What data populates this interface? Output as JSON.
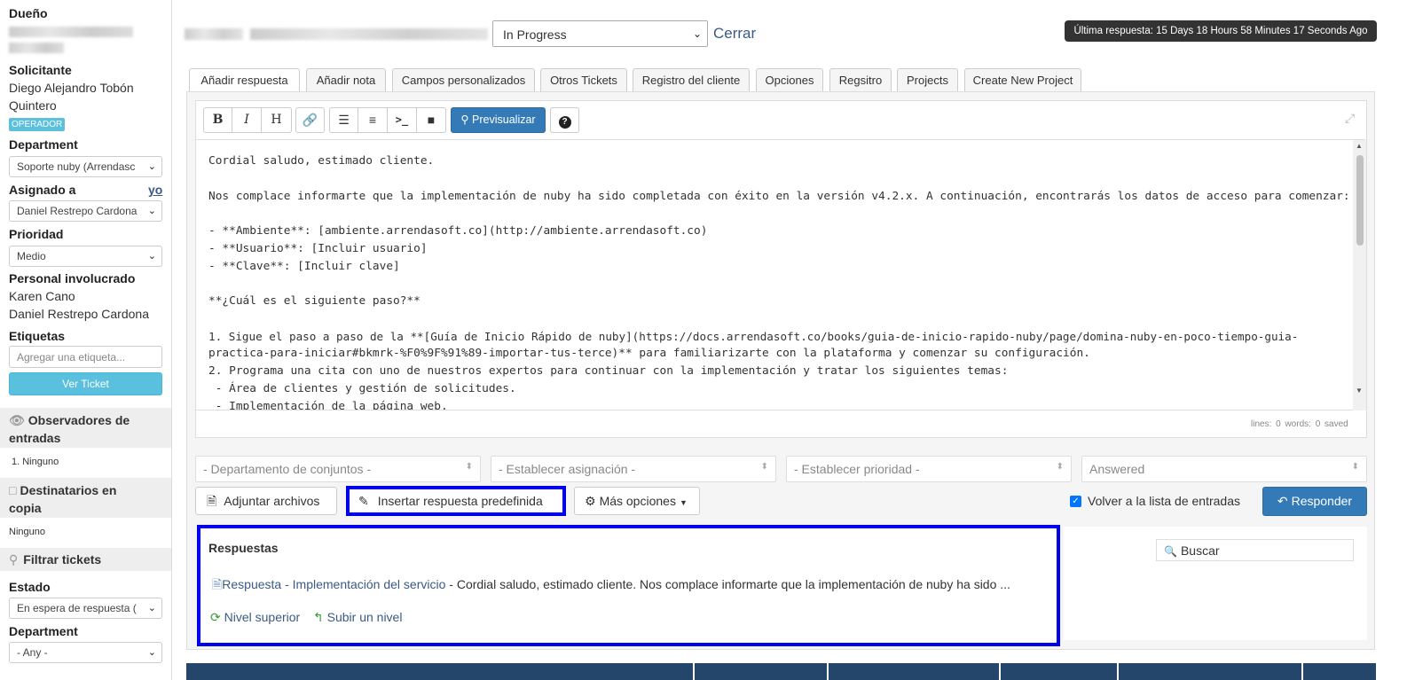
{
  "sidebar": {
    "owner_label": "Dueño",
    "requester_label": "Solicitante",
    "requester_name_line1": "Diego Alejandro Tobón",
    "requester_name_line2": "Quintero",
    "requester_badge": "OPERADOR",
    "department_label": "Department",
    "department_value": "Soporte nuby (Arrendasc",
    "assigned_label": "Asignado a",
    "assigned_me_link": "yo",
    "assigned_value": "Daniel Restrepo Cardona",
    "priority_label": "Prioridad",
    "priority_value": "Medio",
    "involved_label": "Personal involucrado",
    "involved": [
      "Karen Cano",
      "Daniel Restrepo Cardona"
    ],
    "tags_label": "Etiquetas",
    "tags_placeholder": "Agregar una etiqueta...",
    "view_ticket_button": "Ver Ticket",
    "watchers_label_line1": "Observadores de",
    "watchers_label_line2": "entradas",
    "watchers_item": "1. Ninguno",
    "cc_label_line1": "Destinatarios en",
    "cc_label_line2": "copia",
    "cc_item": "Ninguno",
    "filter_label": "Filtrar tickets",
    "state_label": "Estado",
    "state_value": "En espera de respuesta (",
    "filter_department_label": "Department",
    "filter_department_value": "- Any -"
  },
  "header": {
    "status_value": "In Progress",
    "close_link": "Cerrar",
    "last_reply": "Última respuesta: 15 Days 18 Hours 58 Minutes 17 Seconds Ago"
  },
  "tabs": [
    {
      "label": "Añadir respuesta",
      "active": true
    },
    {
      "label": "Añadir nota"
    },
    {
      "label": "Campos personalizados"
    },
    {
      "label": "Otros Tickets"
    },
    {
      "label": "Registro del cliente"
    },
    {
      "label": "Opciones"
    },
    {
      "label": "Regsitro"
    },
    {
      "label": "Projects"
    },
    {
      "label": "Create New Project"
    }
  ],
  "toolbar": {
    "bold": "B",
    "italic": "I",
    "heading": "H",
    "preview": "Previsualizar",
    "help": "?"
  },
  "editor": {
    "lines": [
      "Cordial saludo, estimado cliente.",
      "",
      "Nos complace informarte que la implementación de nuby ha sido completada con éxito en la versión v4.2.x. A continuación, encontrarás los datos de acceso para comenzar:",
      "",
      "- **Ambiente**: [ambiente.arrendasoft.co](http://ambiente.arrendasoft.co)",
      "- **Usuario**: [Incluir usuario]",
      "- **Clave**: [Incluir clave]",
      "",
      "**¿Cuál es el siguiente paso?**",
      "",
      "1. Sigue el paso a paso de la **[Guía de Inicio Rápido de nuby](https://docs.arrendasoft.co/books/guia-de-inicio-rapido-nuby/page/domina-nuby-en-poco-tiempo-guia-",
      "practica-para-iniciar#bkmrk-%F0%9F%91%89-importar-tus-terce)** para familiarizarte con la plataforma y comenzar su configuración.",
      "2. Programa una cita con uno de nuestros expertos para continuar con la implementación y tratar los siguientes temas:",
      " - Área de clientes y gestión de solicitudes.",
      " - Implementación de la página web."
    ],
    "status": "lines: 0   words: 0   saved"
  },
  "bottom_selects": {
    "department": "- Departamento de conjuntos -",
    "assignment": "- Establecer asignación -",
    "priority": "- Establecer prioridad -",
    "status": "Answered"
  },
  "actions": {
    "attach": "Adjuntar archivos",
    "insert_predefined": "Insertar respuesta predefinida",
    "more_options": "Más opciones",
    "back_to_list": "Volver a la lista de entradas",
    "reply": "Responder"
  },
  "responses": {
    "title": "Respuestas",
    "item_link": "Respuesta - Implementación del servicio",
    "item_preview": " - Cordial saludo, estimado cliente. Nos complace informarte que la implementación de nuby ha sido ...",
    "top_level": "Nivel superior",
    "up_level": "Subir un nivel",
    "search_placeholder": "Buscar"
  },
  "colors": {
    "primary": "#337ab7",
    "info": "#5bc0de",
    "highlight_border": "#0000ee",
    "bottom_bar": "#25466b"
  }
}
